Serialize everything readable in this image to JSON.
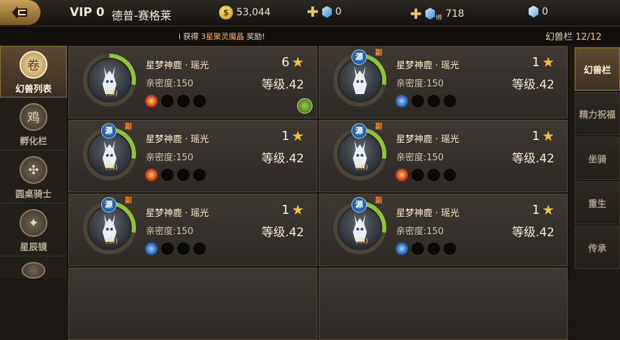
{
  "header": {
    "vip": "VIP 0",
    "player_name": "德普-赛格莱",
    "gold": "53,044",
    "gem_free": "0",
    "gem_bound": "718",
    "gem_bound_tag": "绑",
    "gem_other": "0"
  },
  "notice": {
    "prefix": "获得",
    "item": "3星聚灵魔晶",
    "suffix": "奖励!"
  },
  "slots": {
    "label": "幻兽栏",
    "count": "12/12"
  },
  "left_nav": [
    {
      "label": "幻兽列表",
      "active": true,
      "icon": "pet-list-icon",
      "glyph": "卷"
    },
    {
      "label": "孵化栏",
      "active": false,
      "icon": "incubator-icon",
      "glyph": "鸡"
    },
    {
      "label": "圆桌骑士",
      "active": false,
      "icon": "round-table-icon",
      "glyph": "✣"
    },
    {
      "label": "星辰镜",
      "active": false,
      "icon": "star-mirror-icon",
      "glyph": "✦"
    }
  ],
  "pets": [
    {
      "name": "星梦神鹿 · 瑶光",
      "intimacy": "亲密度:150",
      "stars": "6",
      "level": "等级.42",
      "bind": "(绑)",
      "source": "",
      "sub": "",
      "skill": "fire",
      "equip": true
    },
    {
      "name": "星梦神鹿 · 瑶光",
      "intimacy": "亲密度:150",
      "stars": "1",
      "level": "等级.42",
      "bind": "",
      "source": "源",
      "sub": "副",
      "skill": "water",
      "equip": false
    },
    {
      "name": "星梦神鹿 · 瑶光",
      "intimacy": "亲密度:150",
      "stars": "1",
      "level": "等级.42",
      "bind": "(绑)",
      "source": "源",
      "sub": "副",
      "skill": "fire",
      "equip": false
    },
    {
      "name": "星梦神鹿 · 瑶光",
      "intimacy": "亲密度:150",
      "stars": "1",
      "level": "等级.42",
      "bind": "(绑)",
      "source": "源",
      "sub": "副",
      "skill": "fire",
      "equip": false
    },
    {
      "name": "星梦神鹿 · 瑶光",
      "intimacy": "亲密度:150",
      "stars": "1",
      "level": "等级.42",
      "bind": "(绑)",
      "source": "源",
      "sub": "副",
      "skill": "water",
      "equip": false
    },
    {
      "name": "星梦神鹿 · 瑶光",
      "intimacy": "亲密度:150",
      "stars": "1",
      "level": "等级.42",
      "bind": "(绑)",
      "source": "源",
      "sub": "副",
      "skill": "water",
      "equip": false
    }
  ],
  "right_tabs": [
    {
      "label": "幻兽栏",
      "active": true
    },
    {
      "label": "精力祝福",
      "active": false
    },
    {
      "label": "坐骑",
      "active": false
    },
    {
      "label": "重生",
      "active": false
    },
    {
      "label": "传承",
      "active": false
    }
  ]
}
